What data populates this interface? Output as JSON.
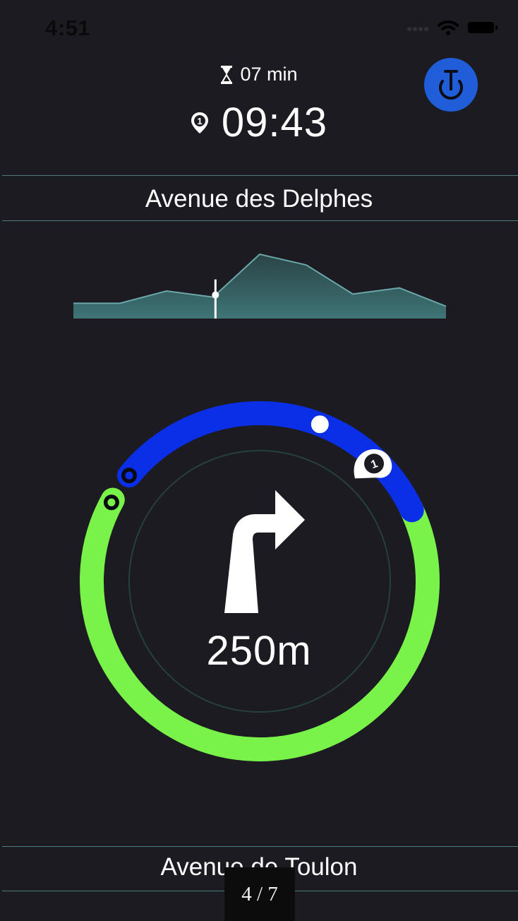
{
  "status_bar": {
    "time": "4:51"
  },
  "header": {
    "eta_duration": "07 min",
    "arrival_time": "09:43",
    "waypoint_badge": "1",
    "icons": [
      "hourglass-icon",
      "waypoint-pin-icon",
      "unicycle-icon"
    ]
  },
  "current_street": "Avenue des Delphes",
  "elevation_profile": {
    "values": [
      10,
      10,
      18,
      14,
      42,
      35,
      16,
      20,
      8
    ],
    "current_index": 3.05
  },
  "maneuver": {
    "distance": "250m",
    "direction": "turn-right",
    "waypoint_marker": "1"
  },
  "next_street": "Avenue de Toulon",
  "pager": "4 / 7",
  "colors": {
    "background": "#1c1b22",
    "route_completed": "#0a2fe6",
    "route_remaining": "#79f24a",
    "accent_button": "#1f5ed8",
    "elevation_fill": "#356163",
    "divider": "#4f7c7c"
  }
}
